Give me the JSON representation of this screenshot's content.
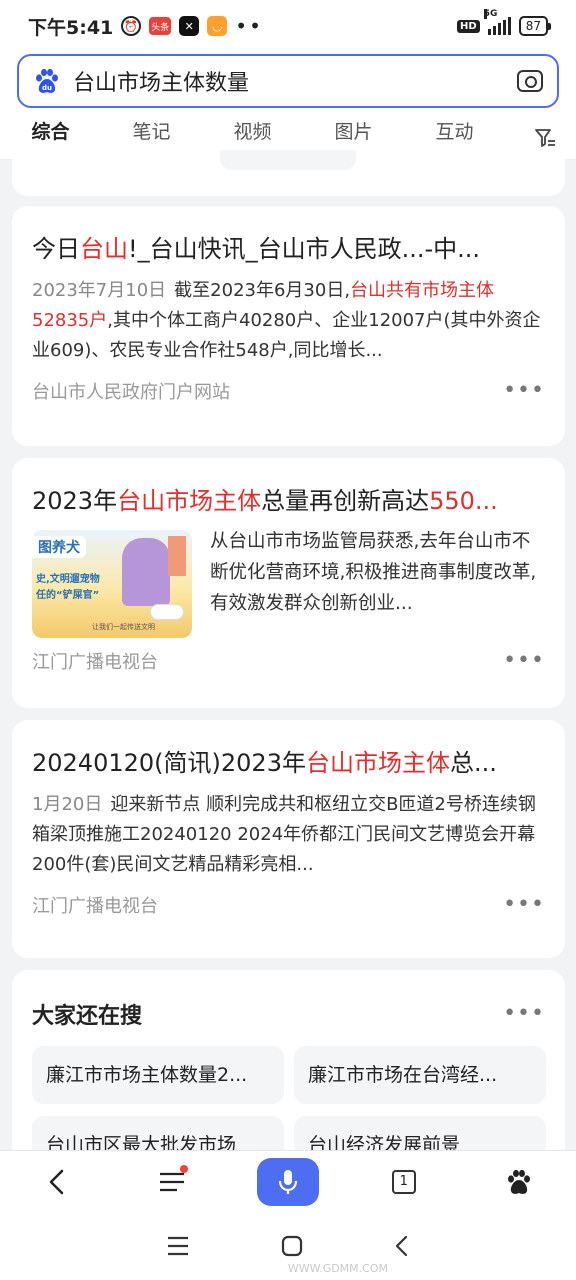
{
  "status_bar": {
    "time": "下午5:41",
    "app1_label": "头条",
    "battery": "87",
    "network": "5G",
    "hd": "HD"
  },
  "search": {
    "query": "台山市场主体数量",
    "logo_text": "du"
  },
  "tabs": [
    {
      "label": "综合",
      "active": true
    },
    {
      "label": "笔记"
    },
    {
      "label": "视频"
    },
    {
      "label": "图片"
    },
    {
      "label": "互动"
    }
  ],
  "results": [
    {
      "title_parts": [
        "今日",
        "台山",
        "!_台山快讯_台山市人民政...-中..."
      ],
      "date": "2023年7月10日",
      "body_pre": "截至2023年6月30日,",
      "body_hl": "台山共有市场主体52835户",
      "body_post": ",其中个体工商户40280户、企业12007户(其中外资企业609)、农民专业合作社548户,同比增长...",
      "source": "台山市人民政府门户网站"
    },
    {
      "title_parts": [
        "2023年",
        "台山市场主体",
        "总量再创新高达",
        "550..."
      ],
      "body": "从台山市市场监管局获悉,去年台山市不断优化营商环境,积极推进商事制度改革,有效激发群众创新创业...",
      "source": "江门广播电视台",
      "thumb": {
        "badge": "图养犬",
        "line1": "史,文明遛宠物",
        "line2": "任的“铲屎官”",
        "footer": "让我们一起传送文明"
      }
    },
    {
      "title_parts": [
        "20240120(简讯)2023年",
        "台山市场主体",
        "总..."
      ],
      "date": "1月20日",
      "body": "迎来新节点 顺利完成共和枢纽立交B匝道2号桥连续钢箱梁顶推施工20240120 2024年侨都江门民间文艺博览会开幕 200件(套)民间文艺精品精彩亮相...",
      "source": "江门广播电视台"
    }
  ],
  "related": {
    "title": "大家还在搜",
    "items": [
      "廉江市市场主体数量2...",
      "廉江市市场在台湾经...",
      "台山市区最大批发市场",
      "台山经济发展前景"
    ]
  },
  "toolbar": {
    "tab_count": "1"
  },
  "watermark": "WWW.GDMM.COM",
  "colors": {
    "accent": "#4e6ef2",
    "highlight": "#e0302e"
  }
}
